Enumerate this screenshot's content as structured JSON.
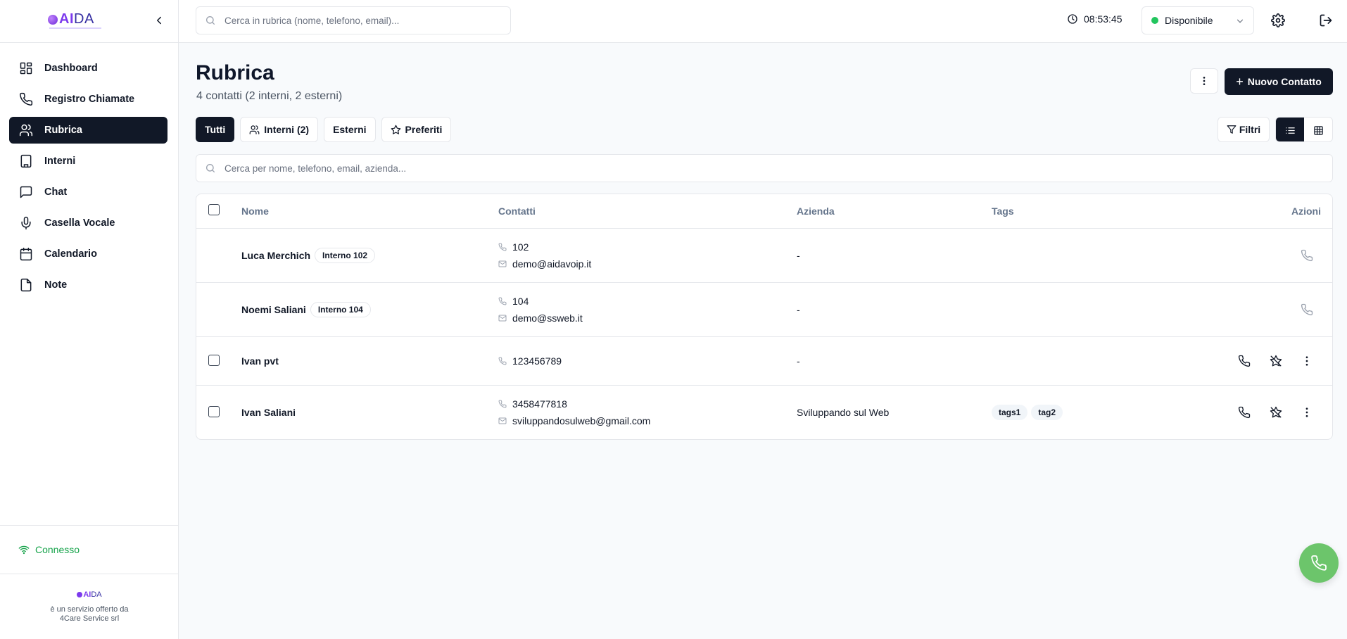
{
  "brand": {
    "logo_prefix": "AI",
    "logo_suffix": "DA"
  },
  "sidebar": {
    "items": [
      {
        "label": "Dashboard",
        "icon": "dashboard-icon"
      },
      {
        "label": "Registro Chiamate",
        "icon": "phone-icon"
      },
      {
        "label": "Rubrica",
        "icon": "users-icon",
        "active": true
      },
      {
        "label": "Interni",
        "icon": "building-icon"
      },
      {
        "label": "Chat",
        "icon": "chat-icon"
      },
      {
        "label": "Casella Vocale",
        "icon": "mic-icon"
      },
      {
        "label": "Calendario",
        "icon": "calendar-icon"
      },
      {
        "label": "Note",
        "icon": "note-icon"
      }
    ],
    "connection_status": "Connesso",
    "footer_line1": "è un servizio offerto da",
    "footer_line2": "4Care Service srl"
  },
  "topbar": {
    "search_placeholder": "Cerca in rubrica (nome, telefono, email)...",
    "clock": "08:53:45",
    "status": "Disponibile",
    "status_color": "#22c55e"
  },
  "page": {
    "title": "Rubrica",
    "subtitle": "4 contatti (2 interni, 2 esterni)",
    "new_contact_label": "Nuovo Contatto",
    "filters_label": "Filtri",
    "tabs": [
      {
        "label": "Tutti",
        "active": true
      },
      {
        "label": "Interni (2)",
        "icon": "users-icon"
      },
      {
        "label": "Esterni"
      },
      {
        "label": "Preferiti",
        "icon": "star-icon"
      }
    ],
    "list_search_placeholder": "Cerca per nome, telefono, email, azienda..."
  },
  "table": {
    "columns": [
      "Nome",
      "Contatti",
      "Azienda",
      "Tags",
      "Azioni"
    ],
    "rows": [
      {
        "name": "Luca Merchich",
        "badge": "Interno 102",
        "phone": "102",
        "email": "demo@aidavoip.it",
        "company": "-",
        "tags": []
      },
      {
        "name": "Noemi Saliani",
        "badge": "Interno 104",
        "phone": "104",
        "email": "demo@ssweb.it",
        "company": "-",
        "tags": []
      },
      {
        "name": "Ivan pvt",
        "badge": "",
        "phone": "123456789",
        "email": "",
        "company": "-",
        "tags": []
      },
      {
        "name": "Ivan Saliani",
        "badge": "",
        "phone": "3458477818",
        "email": "sviluppandosulweb@gmail.com",
        "company": "Sviluppando sul Web",
        "tags": [
          "tags1",
          "tag2"
        ]
      }
    ]
  },
  "colors": {
    "primary": "#111827",
    "success": "#16a34a",
    "fab": "#6cc56b"
  }
}
